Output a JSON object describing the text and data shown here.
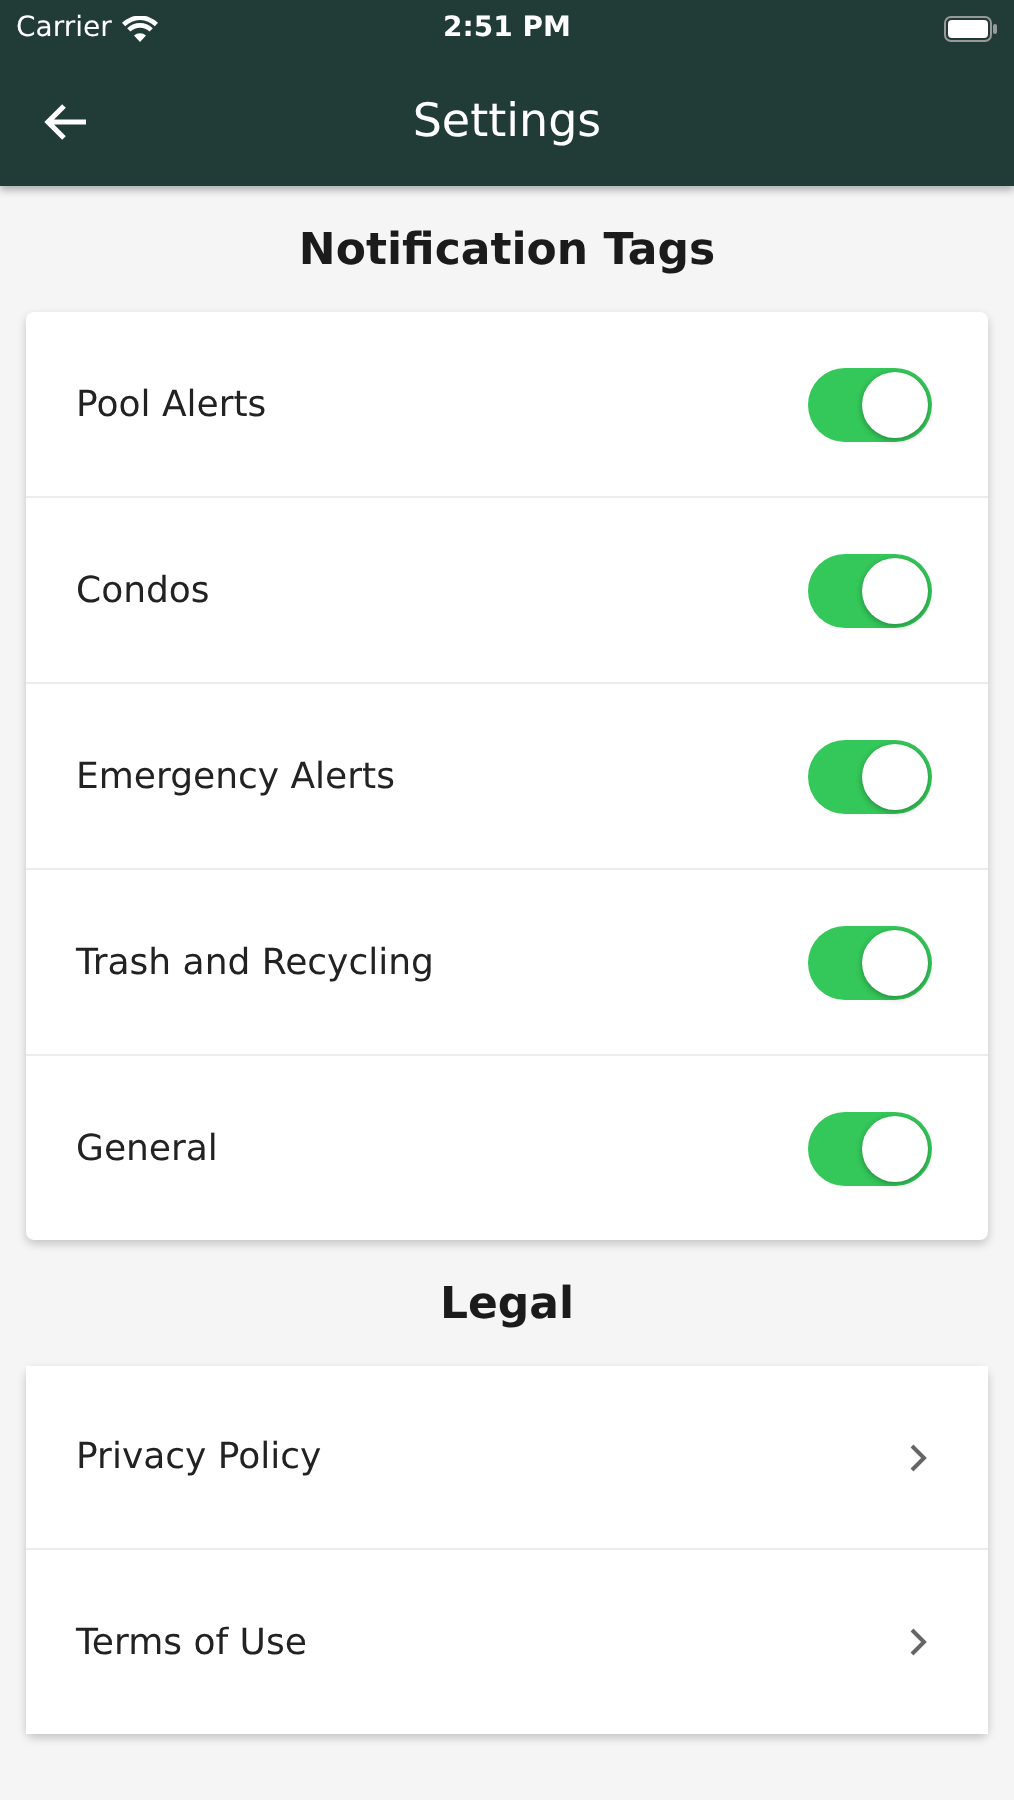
{
  "status_bar": {
    "carrier": "Carrier",
    "time": "2:51 PM"
  },
  "header": {
    "title": "Settings"
  },
  "sections": [
    {
      "title": "Notification Tags",
      "rows": [
        {
          "kind": "toggle",
          "label": "Pool Alerts",
          "on": true
        },
        {
          "kind": "toggle",
          "label": "Condos",
          "on": true
        },
        {
          "kind": "toggle",
          "label": "Emergency Alerts",
          "on": true
        },
        {
          "kind": "toggle",
          "label": "Trash and Recycling",
          "on": true
        },
        {
          "kind": "toggle",
          "label": "General",
          "on": true
        }
      ]
    },
    {
      "title": "Legal",
      "rows": [
        {
          "kind": "link",
          "label": "Privacy Policy"
        },
        {
          "kind": "link",
          "label": "Terms of Use"
        }
      ]
    }
  ]
}
